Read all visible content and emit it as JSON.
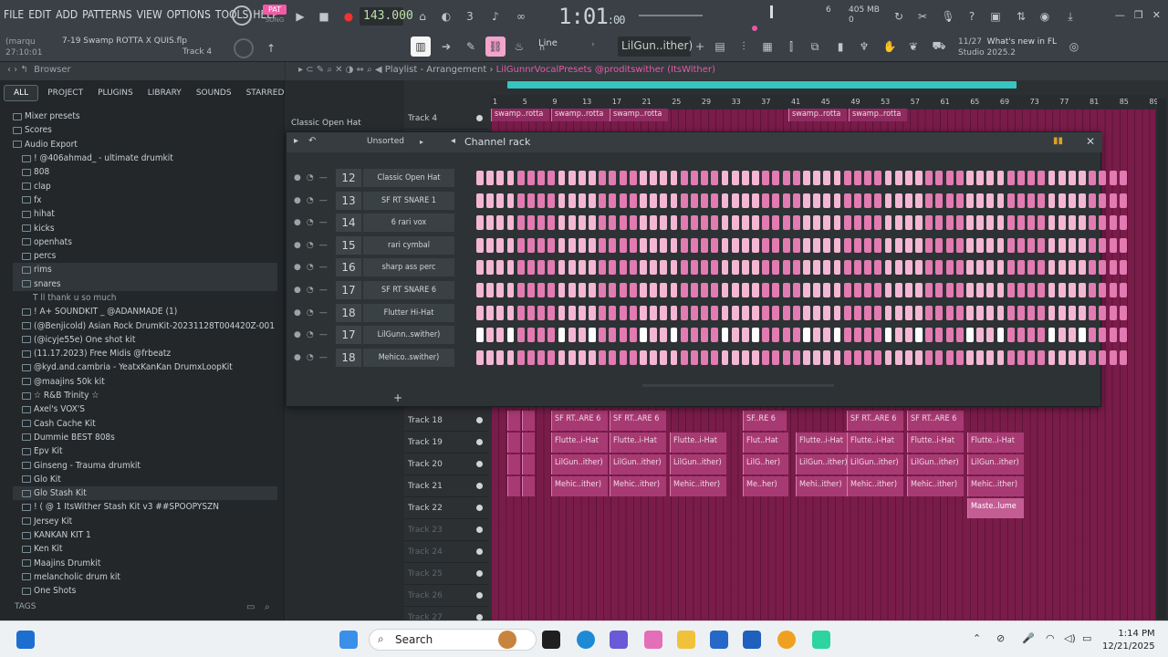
{
  "menu": [
    "FILE",
    "EDIT",
    "ADD",
    "PATTERNS",
    "VIEW",
    "OPTIONS",
    "TOOLS",
    "HELP"
  ],
  "transport": {
    "pat": "PAT",
    "song": "SONG",
    "tempo": "143.000",
    "time_main": "1:01",
    "time_sub": ":00"
  },
  "meters": {
    "cpu_num": "6",
    "mem": "405 MB",
    "mem2": "0"
  },
  "project": {
    "user": "(marqu",
    "name": "7-19 Swamp ROTTA X QUIS.flp",
    "time": "27:10:01",
    "track": "Track 4"
  },
  "toolbar": {
    "snap": "Line",
    "preset": "LilGun..ither)"
  },
  "news": {
    "count": "11/27",
    "title": "What's new in FL",
    "subtitle": "Studio 2025.2"
  },
  "browser": {
    "title": "Browser",
    "tabs": [
      "ALL",
      "PROJECT",
      "PLUGINS",
      "LIBRARY",
      "SOUNDS",
      "STARRED"
    ],
    "items": [
      {
        "label": "Mixer presets",
        "lvl": 0
      },
      {
        "label": "Scores",
        "lvl": 0
      },
      {
        "label": "Audio Export",
        "lvl": 0
      },
      {
        "label": "! @406ahmad_ - ultimate drumkit",
        "lvl": 1
      },
      {
        "label": "808",
        "lvl": 1
      },
      {
        "label": "clap",
        "lvl": 1
      },
      {
        "label": "fx",
        "lvl": 1
      },
      {
        "label": "hihat",
        "lvl": 1
      },
      {
        "label": "kicks",
        "lvl": 1
      },
      {
        "label": "openhats",
        "lvl": 1
      },
      {
        "label": "percs",
        "lvl": 1
      },
      {
        "label": "rims",
        "lvl": 1
      },
      {
        "label": "snares",
        "lvl": 1
      },
      {
        "label": "T ll thank u so much",
        "lvl": 2
      },
      {
        "label": "! A+ SOUNDKIT _ @ADANMADE (1)",
        "lvl": 1
      },
      {
        "label": "(@Benjicold) Asian Rock DrumKit-20231128T004420Z-001",
        "lvl": 1
      },
      {
        "label": "(@icyje55e) One shot kit",
        "lvl": 1
      },
      {
        "label": "(11.17.2023) Free Midis @frbeatz",
        "lvl": 1
      },
      {
        "label": "@kyd.and.cambria - YeatxKanKan DrumxLoopKit",
        "lvl": 1
      },
      {
        "label": "@maajins 50k kit",
        "lvl": 1
      },
      {
        "label": "☆ R&B Trinity ☆",
        "lvl": 1
      },
      {
        "label": "Axel's VOX'S",
        "lvl": 1
      },
      {
        "label": "Cash Cache Kit",
        "lvl": 1
      },
      {
        "label": "Dummie BEST 808s",
        "lvl": 1
      },
      {
        "label": "Epv Kit",
        "lvl": 1
      },
      {
        "label": "Ginseng - Trauma drumkit",
        "lvl": 1
      },
      {
        "label": "Glo Kit",
        "lvl": 1
      },
      {
        "label": "Glo Stash Kit",
        "lvl": 1
      },
      {
        "label": "! ( @ 1 ItsWither Stash Kit v3 ##SPOOPYSZN",
        "lvl": 1
      },
      {
        "label": "Jersey Kit",
        "lvl": 1
      },
      {
        "label": "KANKAN KIT 1",
        "lvl": 1
      },
      {
        "label": "Ken Kit",
        "lvl": 1
      },
      {
        "label": "Maajins Drumkit",
        "lvl": 1
      },
      {
        "label": "melancholic drum kit",
        "lvl": 1
      },
      {
        "label": "One Shots",
        "lvl": 1
      }
    ],
    "tags": "TAGS",
    "sel_item": "Classic Open Hat"
  },
  "playlist": {
    "title_prefix": "Playlist - Arrangement",
    "title_sep": "›",
    "title_name": "LilGunnrVocalPresets @proditswither (ItsWither)",
    "ruler": [
      "1",
      "5",
      "9",
      "13",
      "17",
      "21",
      "25",
      "29",
      "33",
      "37",
      "41",
      "45",
      "49",
      "53",
      "57",
      "61",
      "65",
      "69",
      "73",
      "77",
      "81",
      "85",
      "89"
    ],
    "top_track": "Track 4",
    "tracks_lower": [
      "Track 18",
      "Track 19",
      "Track 20",
      "Track 21",
      "Track 22",
      "Track 23",
      "Track 24",
      "Track 25",
      "Track 26",
      "Track 27"
    ],
    "clips_top": [
      "swamp..rotta",
      "swamp..rotta",
      "swamp..rotta",
      "swamp..rotta",
      "swamp..rotta"
    ],
    "row18": [
      "SF RT..ARE 6",
      "SF RT..ARE 6",
      "SF..RE 6",
      "SF RT..ARE 6",
      "SF RT..ARE 6"
    ],
    "row19": [
      "Flutte..i-Hat",
      "Flutte..i-Hat",
      "Flutte..i-Hat",
      "Flut..Hat",
      "Flutte..i-Hat",
      "Flutte..i-Hat",
      "Flutte..i-Hat",
      "Flutte..i-Hat"
    ],
    "row20": [
      "LilGun..ither)",
      "LilGun..ither)",
      "LilGun..ither)",
      "LilG..her)",
      "LilGun..ither)",
      "LilGun..ither)",
      "LilGun..ither)",
      "LilGun..ither)"
    ],
    "row21": [
      "Mehic..ither)",
      "Mehic..ither)",
      "Mehic..ither)",
      "Me..her)",
      "Mehi..ither)",
      "Mehic..ither)",
      "Mehic..ither)",
      "Mehic..ither)"
    ],
    "row22": [
      "Maste..lume"
    ]
  },
  "channel_rack": {
    "title": "Channel rack",
    "group": "Unsorted",
    "channels": [
      {
        "num": "12",
        "name": "Classic Open Hat"
      },
      {
        "num": "13",
        "name": "SF RT SNARE 1"
      },
      {
        "num": "14",
        "name": "6 rari vox"
      },
      {
        "num": "15",
        "name": "rari cymbal"
      },
      {
        "num": "16",
        "name": "sharp ass perc"
      },
      {
        "num": "17",
        "name": "SF RT SNARE 6"
      },
      {
        "num": "18",
        "name": "Flutter Hi-Hat"
      },
      {
        "num": "17",
        "name": "LilGunn..swither)"
      },
      {
        "num": "18",
        "name": "Mehico..swither)"
      }
    ]
  },
  "taskbar": {
    "search": "Search",
    "time": "1:14 PM",
    "date": "12/21/2025"
  }
}
